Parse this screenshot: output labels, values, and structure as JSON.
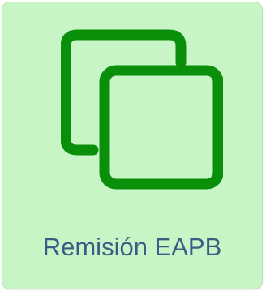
{
  "tile": {
    "label": "Remisión EAPB",
    "icon": "copy-icon",
    "background_color": "#c8f5c6",
    "icon_color": "#0a8f0a",
    "label_color": "#3a5d86"
  }
}
